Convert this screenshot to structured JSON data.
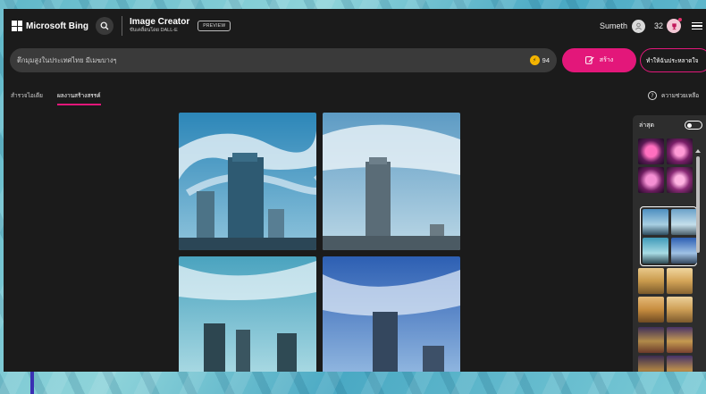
{
  "header": {
    "brand": "Microsoft Bing",
    "app_title": "Image Creator",
    "app_subtitle": "ขับเคลื่อนโดย DALL-E",
    "preview_badge": "PREVIEW",
    "user_name": "Sumeth",
    "reward_count": "32"
  },
  "prompt": {
    "value": "ตึกมุมสูงในประเทศไทย มีเมฆบางๆ",
    "boost_count": "94",
    "create_label": "สร้าง",
    "surprise_label": "ทำให้ฉันประหลาดใจ"
  },
  "tabs": [
    {
      "label": "สำรวจไอเดีย",
      "active": false
    },
    {
      "label": "ผลงานสร้างสรรค์",
      "active": true
    }
  ],
  "help_label": "ความช่วยเหลือ",
  "sidebar": {
    "title": "ล่าสุด"
  },
  "colors": {
    "accent": "#e3177a",
    "app_bg": "#1b1b1b",
    "panel_bg": "#2d2d2d"
  }
}
